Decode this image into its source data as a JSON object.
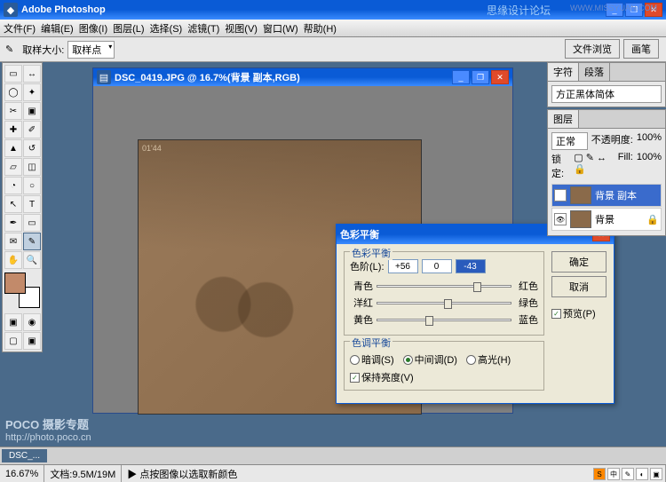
{
  "app": {
    "title": "Adobe Photoshop"
  },
  "forum": {
    "text": "思缘设计论坛",
    "url": "WWW.MISSYUAN.COM"
  },
  "menu": {
    "file": "文件(F)",
    "edit": "编辑(E)",
    "image": "图像(I)",
    "layer": "图层(L)",
    "select": "选择(S)",
    "filter": "滤镜(T)",
    "view": "视图(V)",
    "window": "窗口(W)",
    "help": "帮助(H)"
  },
  "options": {
    "sample": "取样大小:",
    "sample_val": "取样点"
  },
  "tabs": {
    "history": "文件浏览",
    "brushes": "画笔"
  },
  "doc": {
    "title": "DSC_0419.JPG @ 16.7%(背景 副本,RGB)",
    "badge": "01'44"
  },
  "dialog": {
    "title": "色彩平衡",
    "group1": "色彩平衡",
    "levels_label": "色阶(L):",
    "levels": [
      "+56",
      "0",
      "-43"
    ],
    "sliders": [
      {
        "left": "青色",
        "right": "红色",
        "pos": 72
      },
      {
        "left": "洋红",
        "right": "绿色",
        "pos": 50
      },
      {
        "left": "黄色",
        "right": "蓝色",
        "pos": 36
      }
    ],
    "group2": "色调平衡",
    "radios": {
      "shadows": "暗调(S)",
      "midtones": "中间调(D)",
      "highlights": "高光(H)"
    },
    "preserve": "保持亮度(V)",
    "ok": "确定",
    "cancel": "取消",
    "preview": "预览(P)"
  },
  "panels": {
    "char_tab": "字符",
    "para_tab": "段落",
    "font": "方正黑体简体",
    "layers_tab": "图层",
    "blend": "正常",
    "opacity_label": "不透明度:",
    "opacity": "100%",
    "lock": "锁定:",
    "fill_label": "Fill:",
    "fill": "100%",
    "layers": [
      {
        "name": "背景 副本"
      },
      {
        "name": "背景"
      }
    ]
  },
  "status": {
    "zoom": "16.67%",
    "docsize": "文档:9.5M/19M",
    "hint": "▶ 点按图像以选取新颜色"
  },
  "doctab": "DSC_...",
  "watermark": {
    "brand": "POCO 摄影专题",
    "url": "http://photo.poco.cn"
  }
}
